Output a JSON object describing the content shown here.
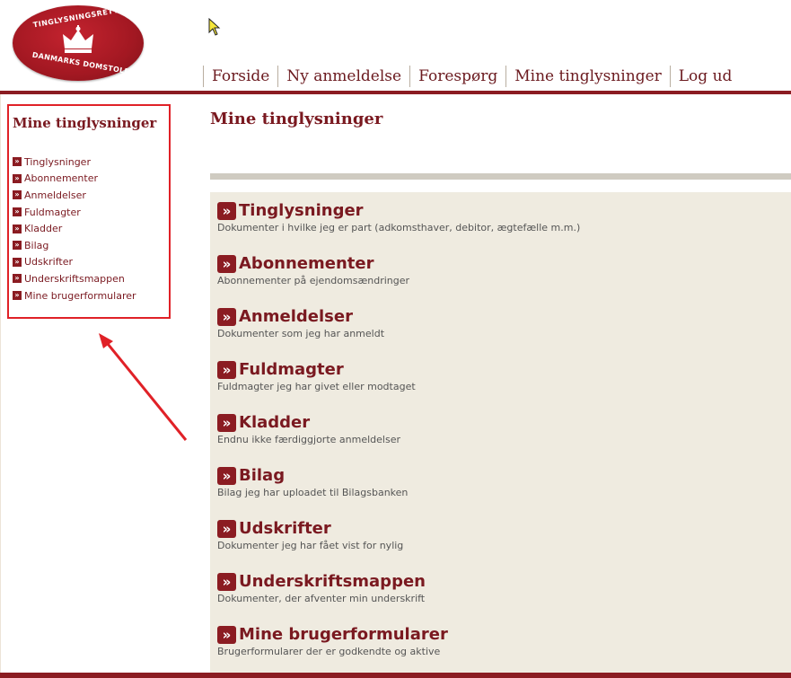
{
  "logo": {
    "top_text": "TINGLYSNINGSRETTEN",
    "bottom_text": "DANMARKS DOMSTOLE"
  },
  "topnav": {
    "items": [
      "Forside",
      "Ny anmeldelse",
      "Forespørg",
      "Mine tinglysninger",
      "Log ud"
    ]
  },
  "sidebar": {
    "title": "Mine tinglysninger",
    "items": [
      "Tinglysninger",
      "Abonnementer",
      "Anmeldelser",
      "Fuldmagter",
      "Kladder",
      "Bilag",
      "Udskrifter",
      "Underskriftsmappen",
      "Mine brugerformularer"
    ]
  },
  "main": {
    "title": "Mine tinglysninger",
    "items": [
      {
        "title": "Tinglysninger",
        "desc": "Dokumenter i hvilke jeg er part (adkomsthaver, debitor, ægtefælle m.m.)"
      },
      {
        "title": "Abonnementer",
        "desc": "Abonnementer på ejendomsændringer"
      },
      {
        "title": "Anmeldelser",
        "desc": "Dokumenter som jeg har anmeldt"
      },
      {
        "title": "Fuldmagter",
        "desc": "Fuldmagter jeg har givet eller modtaget"
      },
      {
        "title": "Kladder",
        "desc": "Endnu ikke færdiggjorte anmeldelser"
      },
      {
        "title": "Bilag",
        "desc": "Bilag jeg har uploadet til Bilagsbanken"
      },
      {
        "title": "Udskrifter",
        "desc": "Dokumenter jeg har fået vist for nylig"
      },
      {
        "title": "Underskriftsmappen",
        "desc": "Dokumenter, der afventer min underskrift"
      },
      {
        "title": "Mine brugerformularer",
        "desc": "Brugerformularer der er godkendte og aktive"
      }
    ]
  },
  "colors": {
    "brand_red": "#8b1c22",
    "highlight_red": "#e02127",
    "panel_bg": "#efebe0"
  }
}
